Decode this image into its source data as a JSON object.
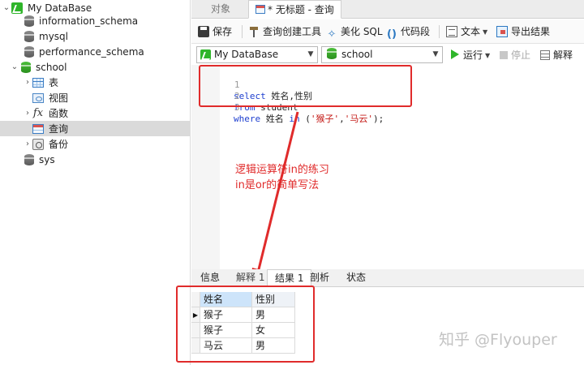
{
  "navigator": {
    "items": [
      {
        "label": "My DataBase"
      },
      {
        "label": "information_schema"
      },
      {
        "label": "mysql"
      },
      {
        "label": "performance_schema"
      },
      {
        "label": "school"
      },
      {
        "label": "表"
      },
      {
        "label": "视图"
      },
      {
        "label": "函数"
      },
      {
        "label": "查询"
      },
      {
        "label": "备份"
      },
      {
        "label": "sys"
      }
    ]
  },
  "tabs": {
    "objects_label": "对象",
    "query_tab_label": "* 无标题 - 查询"
  },
  "toolbar": {
    "save": "保存",
    "query_builder": "查询创建工具",
    "beautify_sql": "美化 SQL",
    "code_snippet": "代码段",
    "text": "文本",
    "export_result": "导出结果"
  },
  "selectbar": {
    "connection": "My DataBase",
    "database": "school",
    "run": "运行",
    "stop": "停止",
    "explain": "解释"
  },
  "editor": {
    "line_numbers": [
      "1",
      "2",
      "3"
    ],
    "line1": {
      "kw": "select",
      "rest": " 姓名,性别"
    },
    "line2": {
      "kw": "from",
      "rest": " student"
    },
    "line3": {
      "kw1": "where",
      "mid": " 姓名 ",
      "kw2": "in",
      "open": " (",
      "s1": "'猴子'",
      "comma": ",",
      "s2": "'马云'",
      "close": ");"
    }
  },
  "annotation": {
    "line1": "逻辑运算符in的练习",
    "line2": "in是or的简单写法"
  },
  "result_tabs": [
    "信息",
    "解释 1",
    "结果 1",
    "剖析",
    "状态"
  ],
  "result_grid": {
    "columns": [
      "姓名",
      "性别"
    ],
    "rows": [
      [
        "猴子",
        "男"
      ],
      [
        "猴子",
        "女"
      ],
      [
        "马云",
        "男"
      ]
    ],
    "current_row_marker": "▶"
  },
  "watermark": "知乎 @Flyouper",
  "colors": {
    "annotation": "#e02b2b",
    "keyword": "#1d3ecf",
    "string": "#c41a16",
    "run": "#2fb52a"
  }
}
